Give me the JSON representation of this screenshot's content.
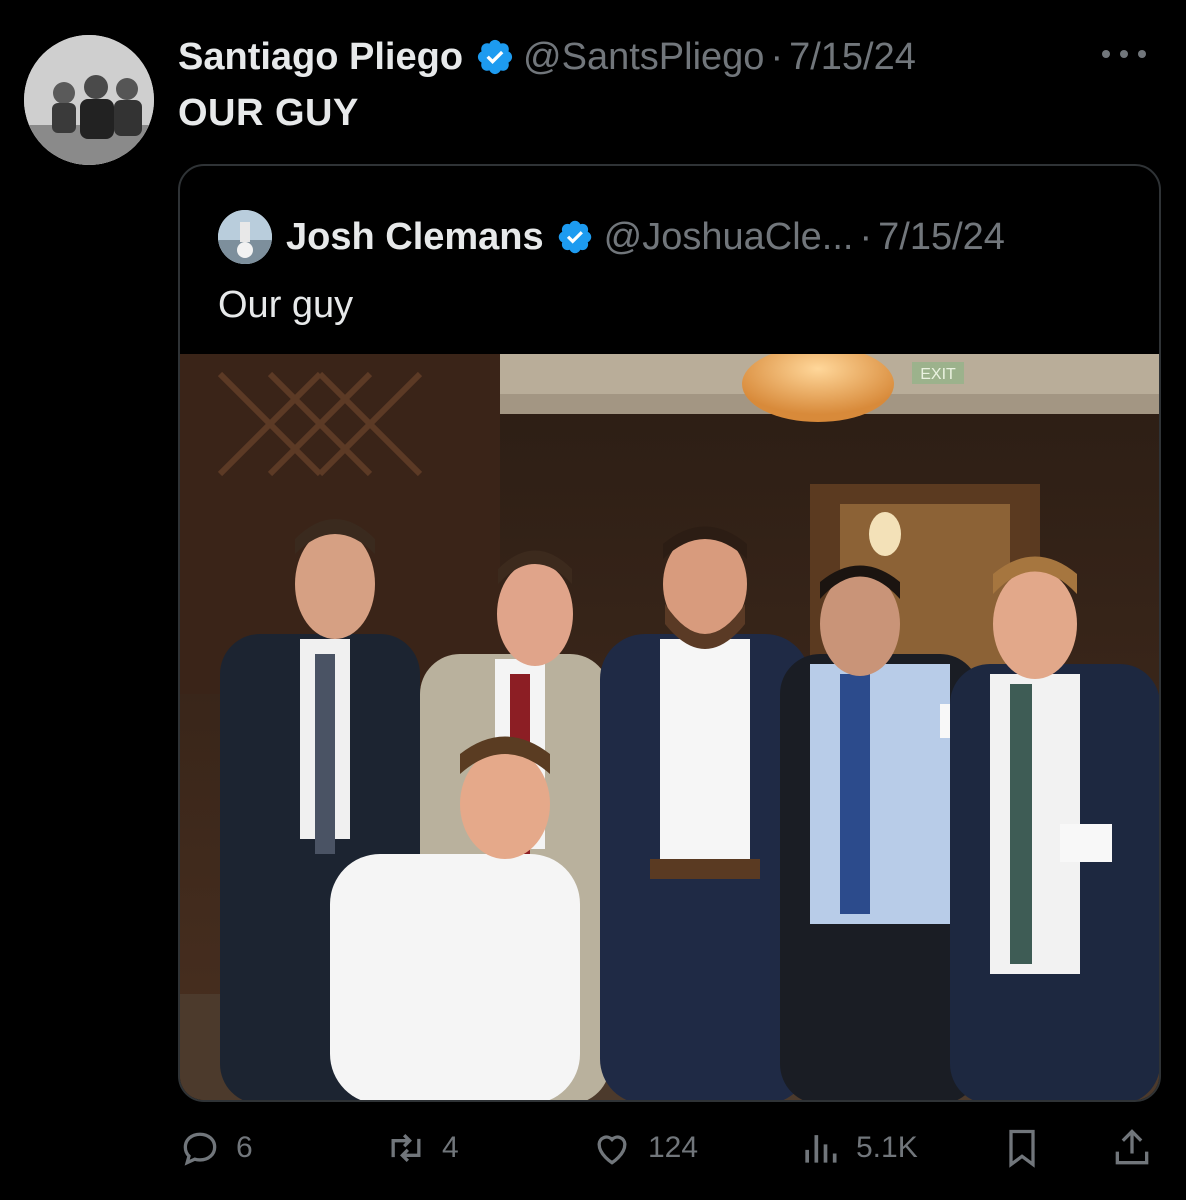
{
  "tweet": {
    "author_name": "Santiago Pliego",
    "author_handle": "@SantsPliego",
    "separator": "·",
    "date": "7/15/24",
    "text": "OUR GUY"
  },
  "quoted_tweet": {
    "author_name": "Josh Clemans",
    "author_handle": "@JoshuaCle...",
    "separator": "·",
    "date": "7/15/24",
    "text": "Our guy"
  },
  "photo": {
    "exit_sign": "EXIT"
  },
  "actions": {
    "replies": "6",
    "reposts": "4",
    "likes": "124",
    "views": "5.1K"
  },
  "icons": {
    "verified_color": "#1d9bf0",
    "more": "more-icon",
    "reply": "reply-icon",
    "repost": "repost-icon",
    "like": "like-icon",
    "views": "views-icon",
    "bookmark": "bookmark-icon",
    "share": "share-icon"
  },
  "colors": {
    "background": "#000000",
    "text_primary": "#e7e9ea",
    "text_secondary": "#71767b",
    "border": "#2f3336"
  }
}
